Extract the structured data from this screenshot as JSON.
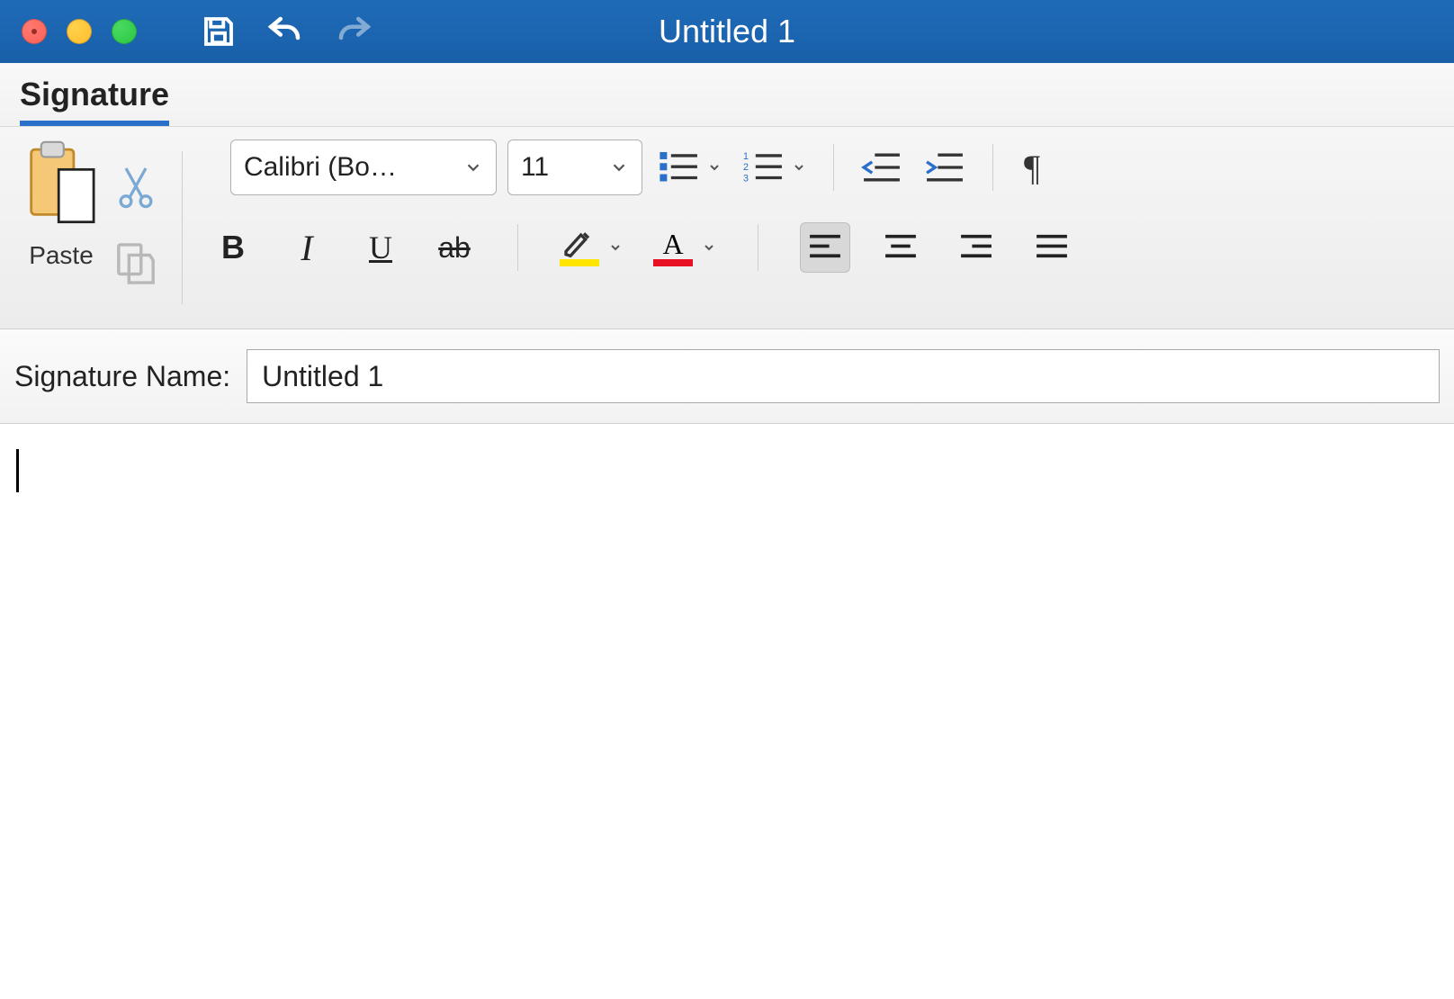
{
  "titlebar": {
    "title": "Untitled 1"
  },
  "ribbon": {
    "tab_label": "Signature",
    "paste_label": "Paste",
    "font_name": "Calibri (Bo…",
    "font_size": "11"
  },
  "form": {
    "signature_label": "Signature Name:",
    "signature_value": "Untitled 1"
  },
  "editor": {
    "content": ""
  }
}
